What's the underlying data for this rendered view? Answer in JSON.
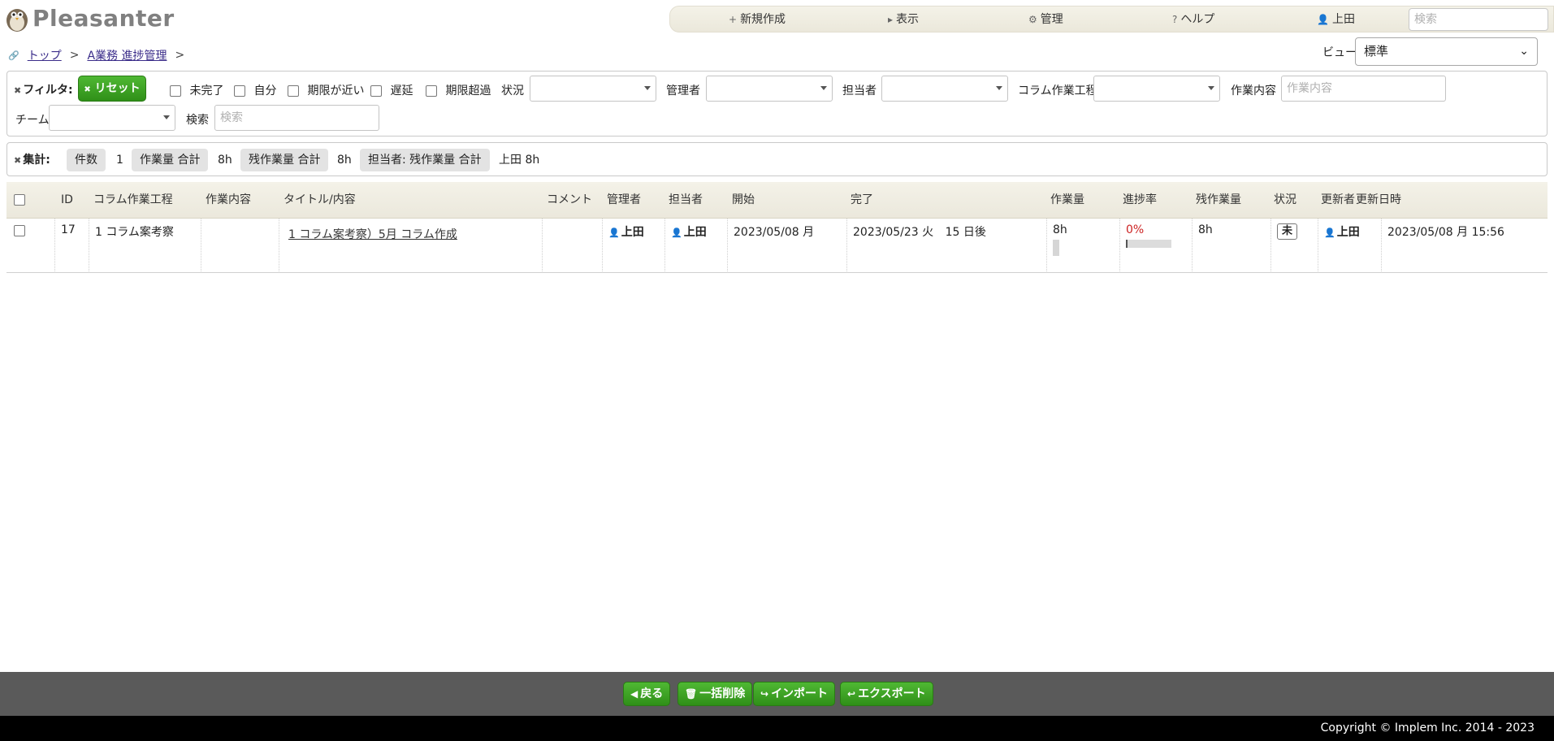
{
  "app": {
    "logo_text": "Pleasanter"
  },
  "top_menu": {
    "new": "新規作成",
    "view": "表示",
    "admin": "管理",
    "help": "ヘルプ",
    "user": "上田",
    "search_placeholder": "検索"
  },
  "breadcrumb": {
    "top": "トップ",
    "site": "A業務 進捗管理",
    "sep": ">"
  },
  "view": {
    "label": "ビュー",
    "selected": "標準"
  },
  "filters": {
    "title": "フィルタ:",
    "reset": "リセット",
    "checks": [
      "未完了",
      "自分",
      "期限が近い",
      "遅延",
      "期限超過"
    ],
    "status_label": "状況",
    "manager_label": "管理者",
    "owner_label": "担当者",
    "process_label": "コラム作業工程",
    "work_label": "作業内容",
    "work_placeholder": "作業内容",
    "team_label": "チーム",
    "search_label": "検索",
    "search_placeholder": "検索"
  },
  "aggregations": {
    "title": "集計:",
    "items": [
      {
        "label": "件数",
        "value": "1"
      },
      {
        "label": "作業量 合計",
        "value": "8h"
      },
      {
        "label": "残作業量 合計",
        "value": "8h"
      },
      {
        "label": "担当者: 残作業量 合計",
        "value": "上田 8h"
      }
    ]
  },
  "grid": {
    "columns": [
      "ID",
      "コラム作業工程",
      "作業内容",
      "タイトル/内容",
      "コメント",
      "管理者",
      "担当者",
      "開始",
      "完了",
      "作業量",
      "進捗率",
      "残作業量",
      "状況",
      "更新者",
      "更新日時"
    ],
    "rows": [
      {
        "id": "17",
        "process": "1 コラム案考察",
        "work": "",
        "title": "1 コラム案考察）5月 コラム作成",
        "comment": "",
        "manager": "上田",
        "owner": "上田",
        "start": "2023/05/08 月",
        "complete": "2023/05/23 火",
        "remaining_days": "15 日後",
        "work_value": "8h",
        "progress": "0%",
        "remaining_work": "8h",
        "status": "未",
        "updator": "上田",
        "updated": "2023/05/08 月 15:56"
      }
    ]
  },
  "footer": {
    "back": "戻る",
    "bulk_delete": "一括削除",
    "import": "インポート",
    "export": "エクスポート",
    "copyright": "Copyright © Implem Inc. 2014 - 2023"
  },
  "colors": {
    "accent_green": "#3a9f22",
    "footer_bg": "#5a5a5a",
    "progress_text": "#cc2222"
  }
}
